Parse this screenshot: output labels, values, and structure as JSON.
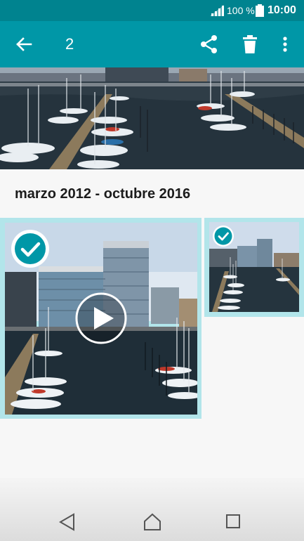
{
  "status_bar": {
    "battery_percent": "100 %",
    "time": "10:00",
    "icons": [
      "signal-icon",
      "battery-icon"
    ]
  },
  "toolbar": {
    "selected_count": "2",
    "icons": [
      "back-arrow-icon",
      "share-icon",
      "trash-icon",
      "more-vert-icon"
    ]
  },
  "gallery": {
    "date_range": "marzo 2012 - octubre 2016",
    "items": [
      {
        "kind": "video",
        "selected": true
      },
      {
        "kind": "photo",
        "selected": true
      }
    ]
  },
  "nav_bar": {
    "icons": [
      "nav-back-icon",
      "nav-home-icon",
      "nav-recent-icon"
    ]
  },
  "colors": {
    "status_bar": "#00838f",
    "toolbar": "#0097a7",
    "selection_bg": "#b2e5ea",
    "check": "#0097a7"
  }
}
